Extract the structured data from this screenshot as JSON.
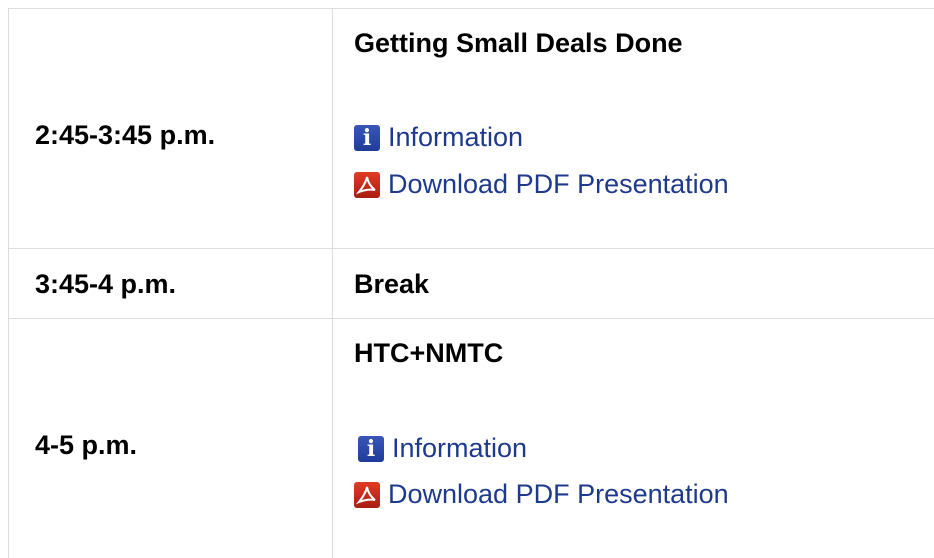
{
  "rows": [
    {
      "time": "2:45-3:45 p.m.",
      "session": "Getting Small Deals Done",
      "links": [
        {
          "icon": "info-icon",
          "glyph": "i",
          "label": "Information"
        },
        {
          "icon": "pdf-icon",
          "label": "Download PDF Presentation"
        }
      ]
    },
    {
      "time": "3:45-4 p.m.",
      "session": "Break"
    },
    {
      "time": "4-5 p.m.",
      "session": "HTC+NMTC",
      "links": [
        {
          "icon": "info-icon",
          "glyph": "i",
          "label": "Information"
        },
        {
          "icon": "pdf-icon",
          "label": "Download PDF Presentation"
        }
      ]
    }
  ],
  "colors": {
    "link": "#1e3a8c",
    "border": "#dddddd",
    "info_icon": "#2a47a8",
    "pdf_icon": "#c72c1b"
  }
}
